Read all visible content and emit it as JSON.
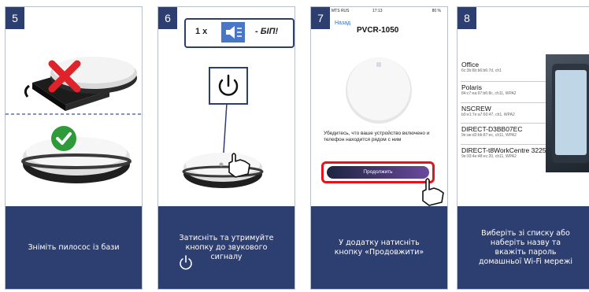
{
  "steps": [
    {
      "number": "5",
      "caption": "Зніміть пилосос із бази"
    },
    {
      "number": "6",
      "caption": "Затисніть та утримуйте кнопку до звукового сигналу"
    },
    {
      "number": "7",
      "caption": "У додатку натисніть кнопку «Продовжити»"
    },
    {
      "number": "8",
      "caption": "Виберіть зі списку або наберіть назву та вкажіть пароль домашньої Wi-Fi мережі"
    }
  ],
  "beep": {
    "count": "1 x",
    "text": "- БІП!"
  },
  "app": {
    "carrier": "MTS RUS",
    "time": "17:13",
    "battery": "80 %",
    "back_label": "Назад",
    "title": "PVCR-1050",
    "instruction": "Убедитесь, что ваше устройство включено и телефон находится рядом с ним",
    "continue_label": "Продолжить"
  },
  "wifi_networks": [
    {
      "name": "Office",
      "details": "6c:3b:6b:b6:b6:7d, ch1"
    },
    {
      "name": "Polaris",
      "details": "84:c7:ea:97:b6:8c, ch11, WPA2"
    },
    {
      "name": "NSCREW",
      "details": "b0:e1:7e:a7:60:47, ch1, WPA2"
    },
    {
      "name": "DIRECT-D3BB07EC",
      "details": "9e:ae:d3:bb:87:ec, ch11, WPA2"
    },
    {
      "name": "DIRECT-t8WorkCentre 3225",
      "details": "9e:93:4e:48:ec:20, ch11, WPA2"
    }
  ],
  "colors": {
    "navy": "#2d3e71",
    "check_green": "#2f9a3a",
    "cross_red": "#e0232a",
    "highlight_red": "#e3141b"
  }
}
